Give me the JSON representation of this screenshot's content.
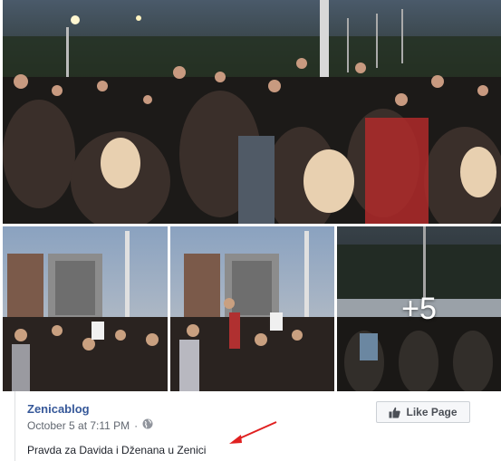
{
  "post": {
    "page_name": "Zenicablog",
    "timestamp": "October 5 at 7:11 PM",
    "separator": "·",
    "privacy_icon": "globe-icon",
    "like_page_label": "Like Page",
    "like_icon": "thumbs-up-icon",
    "caption": "Pravda za Davida i Dženana u Zenici"
  },
  "photos": {
    "more_count": "+5"
  },
  "annotation": {
    "arrow_color": "#e02020"
  },
  "colors": {
    "link": "#365899",
    "meta": "#616770"
  }
}
